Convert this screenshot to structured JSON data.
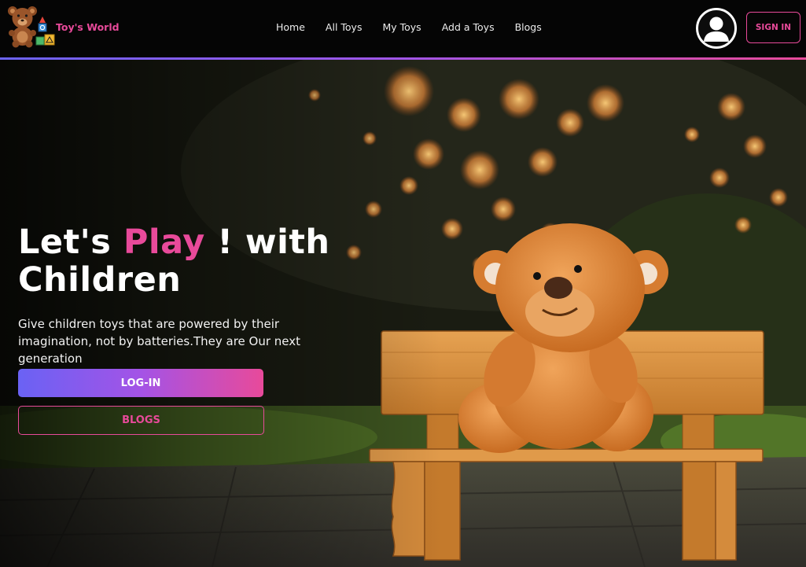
{
  "brand": {
    "name": "Toy's World",
    "logo_icon": "teddy-bear-with-blocks-icon"
  },
  "nav": {
    "links": [
      {
        "label": "Home"
      },
      {
        "label": "All Toys"
      },
      {
        "label": "My Toys"
      },
      {
        "label": "Add a Toys"
      },
      {
        "label": "Blogs"
      }
    ],
    "avatar_icon": "user-avatar-icon",
    "signin_label": "SIGN IN"
  },
  "hero": {
    "title_part1": "Let's ",
    "title_highlight": "Play",
    "title_part2": " ! with Children",
    "subtitle": "Give children toys that are powered by their imagination, not by batteries.They are Our next generation",
    "login_label": "LOG-IN",
    "blogs_label": "BLOGS",
    "image_subject": "teddy bear sitting on wooden bench"
  },
  "colors": {
    "accent_pink": "#e84a9a",
    "accent_purple": "#6a62f4",
    "nav_background": "#050505"
  }
}
